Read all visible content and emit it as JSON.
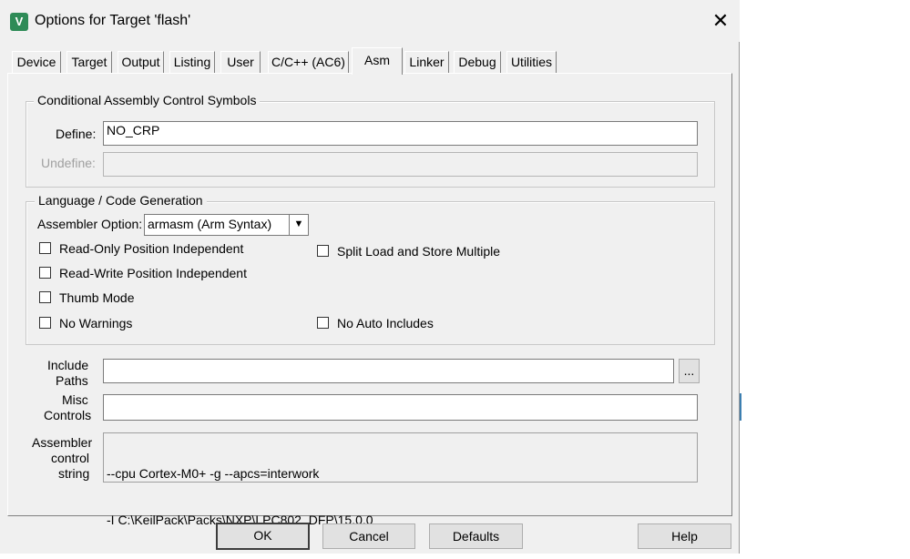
{
  "window": {
    "title": "Options for Target 'flash'",
    "icon": "keil-uvision-icon"
  },
  "tabs": [
    {
      "label": "Device"
    },
    {
      "label": "Target"
    },
    {
      "label": "Output"
    },
    {
      "label": "Listing"
    },
    {
      "label": "User"
    },
    {
      "label": "C/C++ (AC6)"
    },
    {
      "label": "Asm",
      "active": true
    },
    {
      "label": "Linker"
    },
    {
      "label": "Debug"
    },
    {
      "label": "Utilities"
    }
  ],
  "conditional": {
    "legend": "Conditional Assembly Control Symbols",
    "define_label": "Define:",
    "define_value": "NO_CRP",
    "undefine_label": "Undefine:",
    "undefine_value": ""
  },
  "language": {
    "legend": "Language / Code Generation",
    "assembler_option_label": "Assembler Option:",
    "assembler_option_value": "armasm (Arm Syntax)",
    "checkboxes": {
      "ro_pi": {
        "label": "Read-Only Position Independent",
        "checked": false
      },
      "rw_pi": {
        "label": "Read-Write Position Independent",
        "checked": false
      },
      "thumb": {
        "label": "Thumb Mode",
        "checked": false
      },
      "no_warnings": {
        "label": "No Warnings",
        "checked": false
      },
      "split_ldm": {
        "label": "Split Load and Store Multiple",
        "checked": false
      },
      "no_auto_includes": {
        "label": "No Auto Includes",
        "checked": false
      }
    }
  },
  "include": {
    "label_1": "Include",
    "label_2": "Paths",
    "value": "",
    "browse_label": "..."
  },
  "misc": {
    "label_1": "Misc",
    "label_2": "Controls",
    "value": ""
  },
  "control_string": {
    "label_1": "Assembler",
    "label_2": "control",
    "label_3": "string",
    "line_1": "--cpu Cortex-M0+ -g --apcs=interwork",
    "line_2": "-I C:\\KeilPack\\Packs\\NXP\\LPC802_DFP\\15.0.0"
  },
  "buttons": {
    "ok": "OK",
    "cancel": "Cancel",
    "defaults": "Defaults",
    "help": "Help"
  }
}
